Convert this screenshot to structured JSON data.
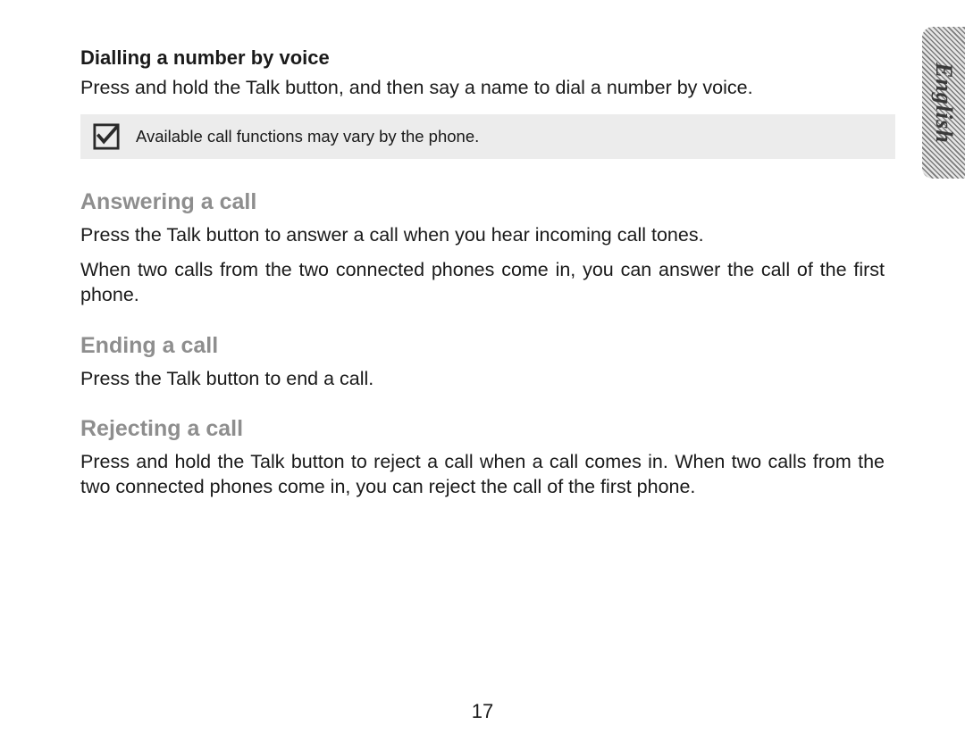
{
  "tab": {
    "language": "English"
  },
  "sections": {
    "dialling": {
      "heading": "Dialling a number by voice",
      "body": "Press and hold the Talk button, and then say a name to dial a number by voice."
    },
    "note": {
      "text": "Available call functions may vary by the phone."
    },
    "answering": {
      "heading": "Answering a call",
      "body1": "Press the Talk button to answer a call when you hear incoming call tones.",
      "body2": "When two calls from the two connected phones come in, you can answer the call of the first phone."
    },
    "ending": {
      "heading": "Ending a call",
      "body": "Press the Talk button to end a call."
    },
    "rejecting": {
      "heading": "Rejecting a call",
      "body": "Press and hold the Talk button to reject a call when a call comes in. When two calls from the two connected phones come in, you can reject the call of the first phone."
    }
  },
  "page_number": "17"
}
